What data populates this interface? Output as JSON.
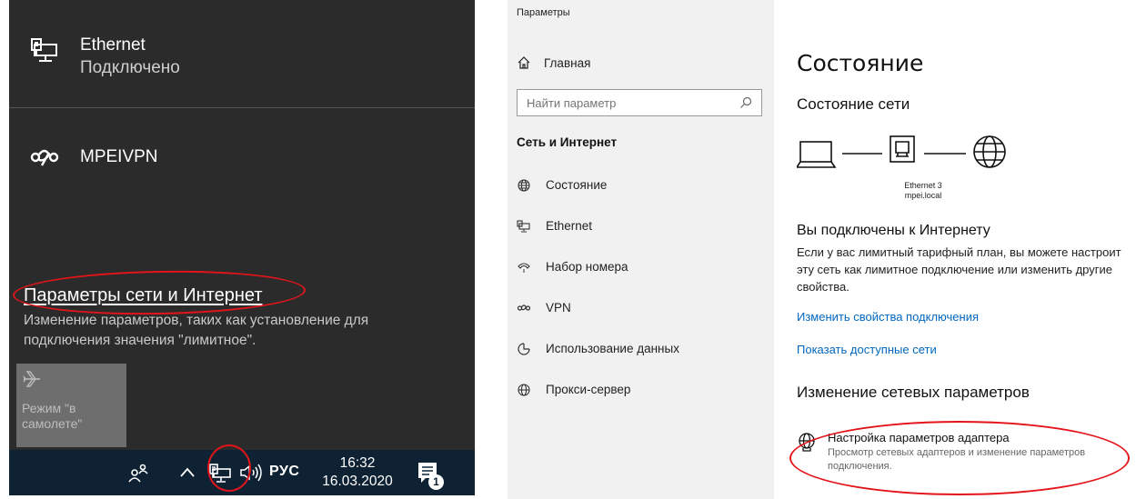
{
  "flyout": {
    "ethernet": {
      "name": "Ethernet",
      "status": "Подключено"
    },
    "vpn": {
      "name": "MPEIVPN"
    },
    "settings_link": "Параметры сети и Интернет",
    "settings_desc": "Изменение параметров, таких как установление для подключения значения \"лимитное\".",
    "airplane_label": "Режим \"в самолете\""
  },
  "taskbar": {
    "lang": "РУС",
    "time": "16:32",
    "date": "16.03.2020",
    "notification_count": "1"
  },
  "settings": {
    "window_title": "Параметры",
    "home": "Главная",
    "search_placeholder": "Найти параметр",
    "section": "Сеть и Интернет",
    "nav": [
      {
        "label": "Состояние",
        "icon": "status-globe-icon"
      },
      {
        "label": "Ethernet",
        "icon": "ethernet-icon"
      },
      {
        "label": "Набор номера",
        "icon": "dialup-icon"
      },
      {
        "label": "VPN",
        "icon": "vpn-icon"
      },
      {
        "label": "Использование данных",
        "icon": "data-usage-icon"
      },
      {
        "label": "Прокси-сервер",
        "icon": "globe-icon"
      }
    ],
    "content": {
      "title": "Состояние",
      "subtitle": "Состояние сети",
      "adapter_name": "Ethernet 3",
      "adapter_domain": "mpei.local",
      "connected": "Вы подключены к Интернету",
      "desc_line1": "Если у вас лимитный тарифный план, вы можете настроит",
      "desc_line2": "эту сеть как лимитное подключение или изменить другие",
      "desc_line3": "свойства.",
      "link_change": "Изменить свойства подключения",
      "link_show": "Показать доступные сети",
      "change_head": "Изменение сетевых параметров",
      "adapter_title": "Настройка параметров адаптера",
      "adapter_desc": "Просмотр сетевых адаптеров и изменение параметров подключения."
    }
  },
  "colors": {
    "flyout_bg": "#2b2b2b",
    "taskbar_bg": "#0f2233",
    "link": "#0067c0",
    "annotation": "#e4141b"
  }
}
